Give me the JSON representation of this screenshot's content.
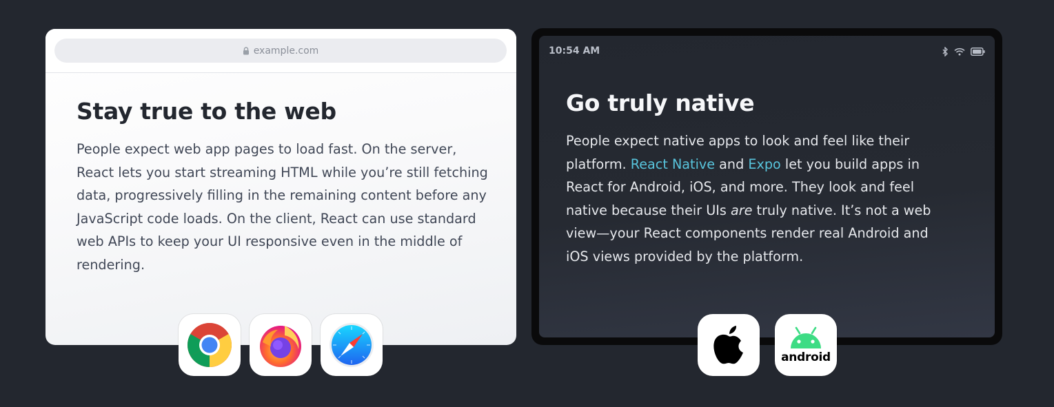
{
  "web_card": {
    "url": "example.com",
    "heading": "Stay true to the web",
    "body": "People expect web app pages to load fast. On the server, React lets you start streaming HTML while you’re still fetching data, progressively filling in the remaining content before any JavaScript code loads. On the client, React can use standard web APIs to keep your UI responsive even in the middle of rendering.",
    "browser_icons": [
      "chrome-icon",
      "firefox-icon",
      "safari-icon"
    ]
  },
  "native_card": {
    "status_time": "10:54 AM",
    "status_icons": [
      "bluetooth-icon",
      "wifi-icon",
      "battery-icon"
    ],
    "heading": "Go truly native",
    "body_1": "People expect native apps to look and feel like their platform. ",
    "link_react_native": "React Native",
    "body_2": " and ",
    "link_expo": "Expo",
    "body_3": " let you build apps in React for Android, iOS, and more. They look and feel native because their UIs ",
    "body_em": "are",
    "body_4": " truly native. It’s not a web view—your React components render real Android and iOS views provided by the platform.",
    "platform_icons": [
      "apple-icon",
      "android-icon"
    ],
    "android_label": "android"
  },
  "colors": {
    "page_bg": "#23272f",
    "link": "#58c4dc",
    "android_green": "#3ddc84"
  }
}
